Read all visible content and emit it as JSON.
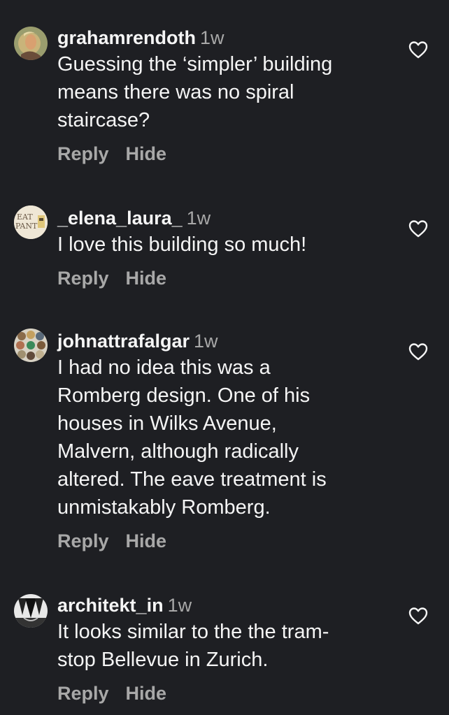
{
  "comments": [
    {
      "username": "grahamrendoth",
      "time": "1w",
      "lines": [
        "Guessing the ‘simpler’ building",
        "means there was no spiral",
        "staircase?"
      ],
      "reply_label": "Reply",
      "hide_label": "Hide",
      "avatar_icon": "profile-photo"
    },
    {
      "username": "_elena_laura_",
      "time": "1w",
      "lines": [
        "I love this building so much!"
      ],
      "reply_label": "Reply",
      "hide_label": "Hide",
      "avatar_icon": "eat-pant-logo",
      "avatar_text": [
        "EAT",
        "PANT"
      ]
    },
    {
      "username": "johnattrafalgar",
      "time": "1w",
      "lines": [
        "I had no idea this was a",
        "Romberg design. One of his",
        "houses in Wilks Avenue,",
        "Malvern, although radically",
        "altered. The eave treatment is",
        "unmistakably Romberg."
      ],
      "reply_label": "Reply",
      "hide_label": "Hide",
      "avatar_icon": "collage-photo"
    },
    {
      "username": "architekt_in",
      "time": "1w",
      "lines": [
        "It looks similar to the the tram-",
        "stop Bellevue in Zurich."
      ],
      "reply_label": "Reply",
      "hide_label": "Hide",
      "avatar_icon": "architecture-photo"
    }
  ],
  "colors": {
    "background": "#1e1f23",
    "primary_text": "#f5f5f5",
    "secondary_text": "#a8a8a8"
  },
  "icons": {
    "like": "heart-outline-icon"
  }
}
